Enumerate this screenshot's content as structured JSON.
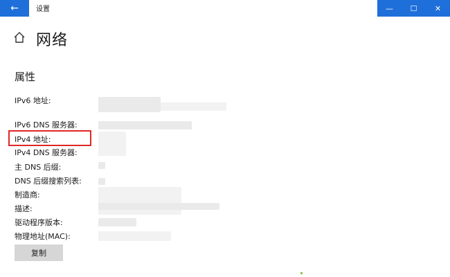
{
  "window": {
    "title": "设置",
    "back_icon": "←",
    "minimize_icon": "—",
    "maximize_icon": "☐",
    "close_icon": "✕",
    "accent": "#1e6fd9"
  },
  "page": {
    "title": "网络",
    "section": "属性"
  },
  "properties": [
    "IPv6 地址:",
    "IPv6 DNS 服务器:",
    "IPv4 地址:",
    "IPv4 DNS 服务器:",
    "主 DNS 后缀:",
    "DNS 后缀搜索列表:",
    "制造商:",
    "描述:",
    "驱动程序版本:",
    "物理地址(MAC):"
  ],
  "actions": {
    "copy_label": "复制"
  },
  "highlight_color": "#e02626"
}
